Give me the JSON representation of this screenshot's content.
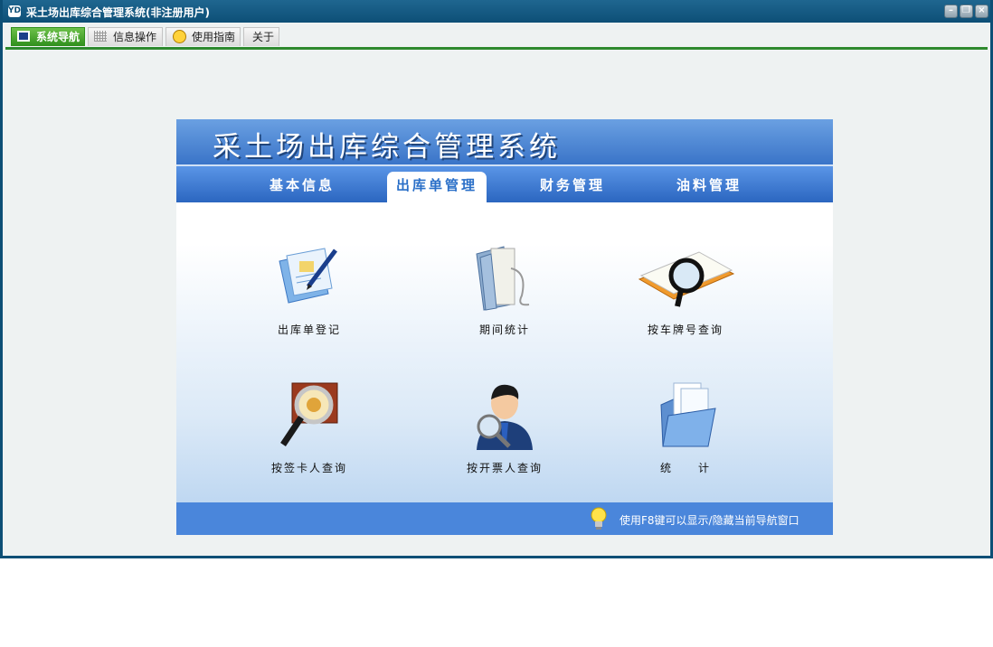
{
  "window": {
    "title": "采土场出库综合管理系统(非注册用户)",
    "app_icon_text": "YD"
  },
  "tabs": [
    {
      "label": "系统导航",
      "icon": "monitor-icon",
      "active": true
    },
    {
      "label": "信息操作",
      "icon": "grid-icon",
      "active": false
    },
    {
      "label": "使用指南",
      "icon": "smiley-icon",
      "active": false
    },
    {
      "label": "关于",
      "icon": "",
      "active": false
    }
  ],
  "nav": {
    "title": "采土场出库综合管理系统",
    "tabs": [
      "基本信息",
      "出库单管理",
      "财务管理",
      "油料管理"
    ],
    "selected_tab": "出库单管理",
    "functions": [
      {
        "label": "出库单登记",
        "icon": "register-document-icon"
      },
      {
        "label": "期间统计",
        "icon": "folder-scroll-icon"
      },
      {
        "label": "按车牌号查询",
        "icon": "book-magnifier-icon"
      },
      {
        "label": "按签卡人查询",
        "icon": "magnifier-icon"
      },
      {
        "label": "按开票人查询",
        "icon": "person-search-icon"
      },
      {
        "label": "统　　计",
        "icon": "folder-documents-icon"
      }
    ],
    "footer_tip": "使用F8键可以显示/隐藏当前导航窗口",
    "footer_icon": "lightbulb-icon"
  },
  "colors": {
    "title_bar": "#0d4f76",
    "active_tab": "#2f8f1c",
    "nav_blue": "#3a74c8"
  }
}
